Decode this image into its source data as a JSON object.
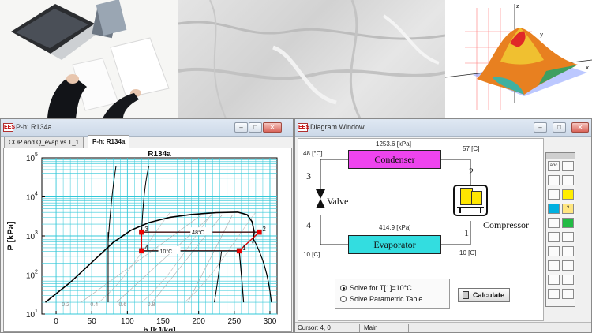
{
  "left_window": {
    "title": "P-h: R134a",
    "tabs": [
      "COP and Q_evap vs T_1",
      "P-h: R134a"
    ],
    "active_tab": 1
  },
  "chart_data": {
    "type": "line",
    "title": "R134a",
    "ylabel": "P [kPa]",
    "xlabel": "h [kJ/kg]",
    "y_scale": "log",
    "ylim": [
      10,
      100000
    ],
    "xlim": [
      -20,
      310
    ],
    "x_ticks": [
      "0",
      "50",
      "100",
      "150",
      "200",
      "250",
      "300"
    ],
    "y_ticks": [
      {
        "base": "10",
        "exp": "1"
      },
      {
        "base": "10",
        "exp": "2"
      },
      {
        "base": "10",
        "exp": "3"
      },
      {
        "base": "10",
        "exp": "4"
      },
      {
        "base": "10",
        "exp": "5"
      }
    ],
    "grid": true,
    "quality_labels": [
      "0.2",
      "0.4",
      "0.6",
      "0.8"
    ],
    "isotherm_labels": [
      "48°C",
      "10°C"
    ],
    "saturation_dome": {
      "liquid": [
        [
          -15,
          20
        ],
        [
          20,
          65
        ],
        [
          50,
          210
        ],
        [
          80,
          680
        ],
        [
          105,
          1400
        ],
        [
          130,
          2200
        ],
        [
          160,
          3000
        ],
        [
          190,
          3550
        ],
        [
          225,
          3950
        ],
        [
          255,
          4050
        ]
      ],
      "vapor": [
        [
          255,
          4050
        ],
        [
          268,
          3500
        ],
        [
          275,
          2300
        ],
        [
          278,
          1250
        ],
        [
          276,
          650
        ]
      ]
    },
    "cycle_points": [
      {
        "label": "1",
        "h": 257,
        "P": 415
      },
      {
        "label": "2",
        "h": 285,
        "P": 1254
      },
      {
        "label": "3",
        "h": 120,
        "P": 1254
      },
      {
        "label": "4",
        "h": 120,
        "P": 415
      }
    ],
    "colors": {
      "grid": "#33c8d8",
      "curve": "#000000",
      "cycle": "#dd0000",
      "point": "#ee0000"
    }
  },
  "right_window": {
    "title": "Diagram Window",
    "condenser_label": "Condenser",
    "evaporator_label": "Evaporator",
    "valve_label": "Valve",
    "compressor_label": "Compressor",
    "p_high": "1253.6",
    "p_high_unit": "[kPa]",
    "p_low": "414.9",
    "p_low_unit": "[kPa]",
    "t3": "48",
    "t3_unit": "[°C]",
    "t2": "57",
    "t2_unit": "[C]",
    "t4": "10",
    "t4_unit": "[C]",
    "t1": "10",
    "t1_unit": "[C]",
    "node_labels": [
      "1",
      "2",
      "3",
      "4"
    ],
    "options": [
      "Solve for T[1]=10°C",
      "Solve Parametric Table"
    ],
    "calculate_label": "Calculate",
    "status": [
      "Cursor: 4, 0",
      "Main"
    ],
    "colors": {
      "condenser": "#ee44ee",
      "evaporator": "#33dde0"
    }
  },
  "palette": {
    "tools": [
      "abc-text-tool",
      "edit-table-tool",
      "line-tool",
      "chart-tool",
      "rectangle-tool",
      "fill-color-tool",
      "circle-tool",
      "help-tool",
      "polyline-tool",
      "polygon-tool",
      "calculator-tool",
      "grid-tool",
      "move-tool",
      "grid-tool-2",
      "align-left-tool",
      "align-right-tool",
      "document-tool",
      "new-document-tool",
      "checkbox-tool",
      "align-center-tool"
    ],
    "tool_text": {
      "abc-text-tool": "abc"
    }
  }
}
